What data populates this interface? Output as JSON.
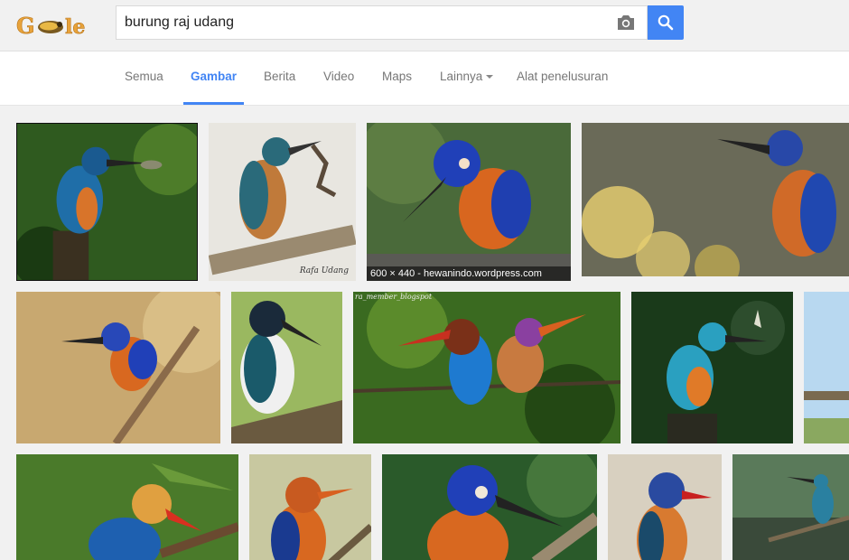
{
  "logo": {
    "text": "Google"
  },
  "search": {
    "query": "burung raj udang"
  },
  "tabs": [
    {
      "label": "Semua"
    },
    {
      "label": "Gambar"
    },
    {
      "label": "Berita"
    },
    {
      "label": "Video"
    },
    {
      "label": "Maps"
    },
    {
      "label": "Lainnya"
    },
    {
      "label": "Alat penelusuran"
    }
  ],
  "results": {
    "hover_caption": "600 × 440 - hewanindo.wordpress.com",
    "watermarks": [
      "Rafa Udang",
      "ra_member_blogspot"
    ]
  },
  "colors": {
    "accent": "#4285f4",
    "background": "#f1f1f1"
  },
  "icons": {
    "camera": "camera-icon",
    "search": "search-icon"
  }
}
